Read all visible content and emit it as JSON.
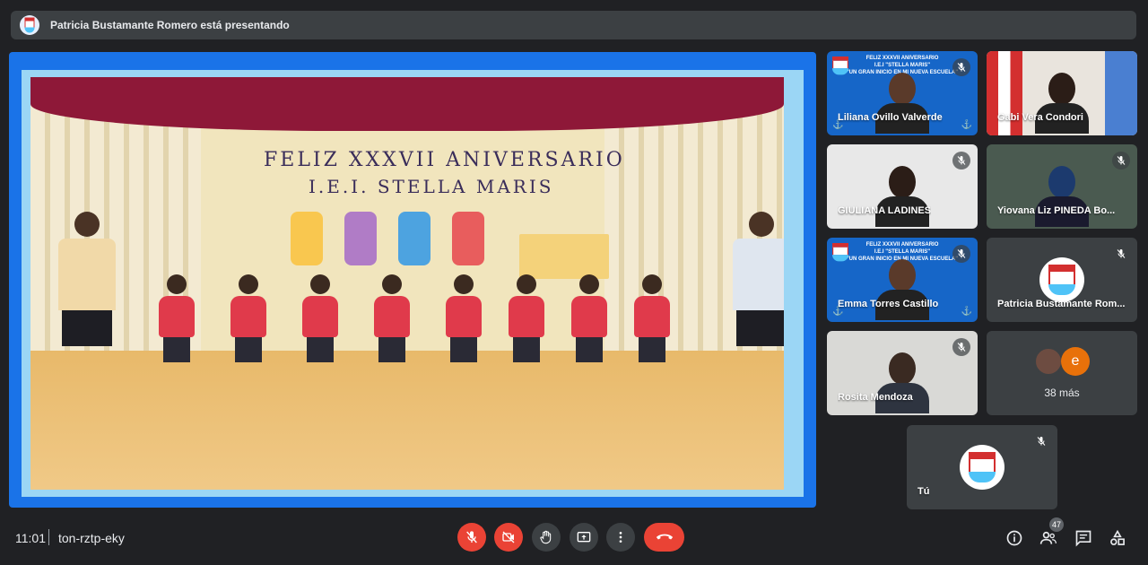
{
  "topbar": {
    "presenting_text": "Patricia Bustamante Romero está presentando"
  },
  "stage": {
    "banner_line1": "FELIZ XXXVII ANIVERSARIO",
    "banner_line2": "I.E.I. STELLA MARIS"
  },
  "tiles": [
    {
      "name": "Liliana Ovillo Valverde",
      "muted": true,
      "style": "blue-banner"
    },
    {
      "name": "Gabi Vera Condori",
      "muted": false,
      "style": "camera"
    },
    {
      "name": "GIULIANA LADINES",
      "muted": true,
      "style": "camera"
    },
    {
      "name": "Yiovana Liz PINEDA Bo...",
      "muted": true,
      "style": "camera"
    },
    {
      "name": "Emma Torres Castillo",
      "muted": true,
      "style": "blue-banner"
    },
    {
      "name": "Patricia Bustamante Rom...",
      "muted": true,
      "style": "avatar"
    },
    {
      "name": "Rosita Mendoza",
      "muted": true,
      "style": "camera"
    },
    {
      "name": "38 más",
      "muted": false,
      "style": "more"
    },
    {
      "name": "Tú",
      "muted": true,
      "style": "avatar"
    }
  ],
  "banner_tile": {
    "line1": "FELIZ XXXVII ANIVERSARIO",
    "line2": "I.E.I \"STELLA MARIS\"",
    "line3": "\"UN GRAN INICIO EN MI NUEVA ESCUELA\""
  },
  "more_avatar_letter": "e",
  "bottombar": {
    "time": "11:01",
    "meeting_code": "ton-rztp-eky",
    "participants_count": "47"
  },
  "colors": {
    "background": "#202124",
    "control_red": "#ea4335",
    "control_dark": "#3c4043",
    "tile_blue": "#1666c8"
  }
}
